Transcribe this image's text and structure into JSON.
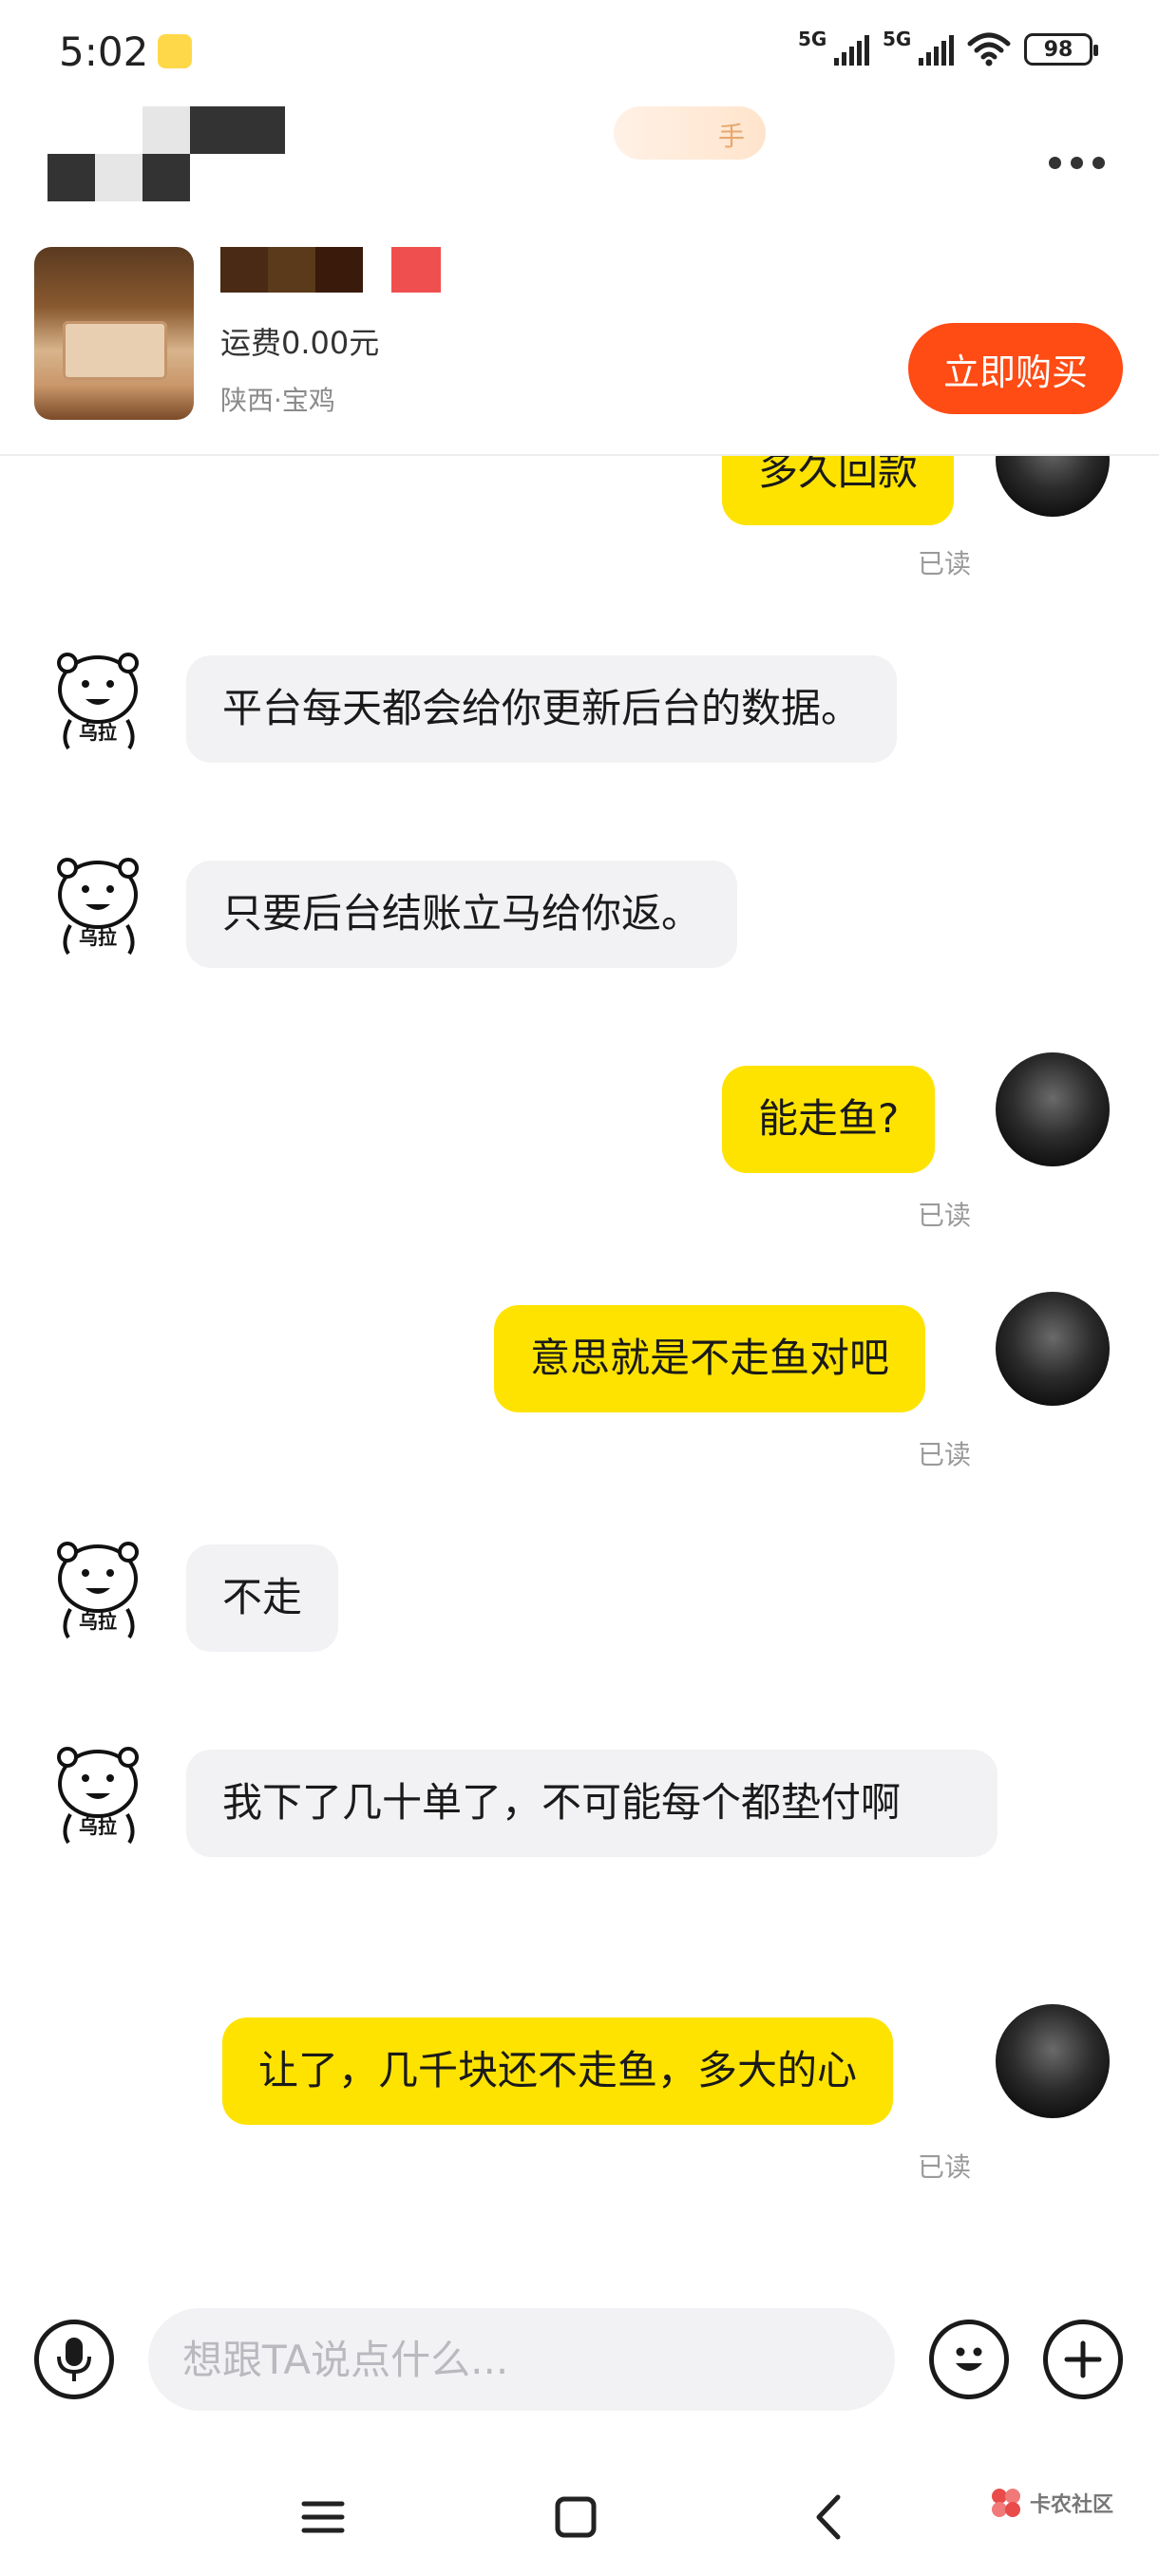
{
  "status_bar": {
    "time": "5:02",
    "network_1": "5G",
    "network_2": "5G",
    "battery": "98"
  },
  "header": {
    "hand_badge": "手",
    "shipping": "运费0.00元",
    "location": "陕西·宝鸡",
    "buy_button": "立即购买"
  },
  "messages": [
    {
      "side": "right",
      "text": "多久回款",
      "status": "已读",
      "partial": true
    },
    {
      "side": "left",
      "text": "平台每天都会给你更新后台的数据。",
      "avatar_caption": "乌拉"
    },
    {
      "side": "left",
      "text": "只要后台结账立马给你返。",
      "avatar_caption": "乌拉"
    },
    {
      "side": "right",
      "text": "能走鱼?",
      "status": "已读"
    },
    {
      "side": "right",
      "text": "意思就是不走鱼对吧",
      "status": "已读"
    },
    {
      "side": "left",
      "text": "不走",
      "avatar_caption": "乌拉"
    },
    {
      "side": "left",
      "text": "我下了几十单了，不可能每个都垫付啊",
      "avatar_caption": "乌拉"
    },
    {
      "side": "right",
      "text": "让了，几千块还不走鱼，多大的心",
      "status": "已读"
    }
  ],
  "input_bar": {
    "placeholder": "想跟TA说点什么..."
  },
  "watermark": {
    "text": "卡农社区"
  },
  "icons": {
    "voice": "microphone-icon",
    "emoji": "smiley-icon",
    "add": "plus-icon",
    "more": "more-dots-icon",
    "nav_menu": "menu-icon",
    "nav_home": "home-square-icon",
    "nav_back": "back-chevron-icon"
  },
  "colors": {
    "buy_button": "#ff4b14",
    "my_bubble": "#ffe300",
    "their_bubble": "#f2f2f5"
  }
}
